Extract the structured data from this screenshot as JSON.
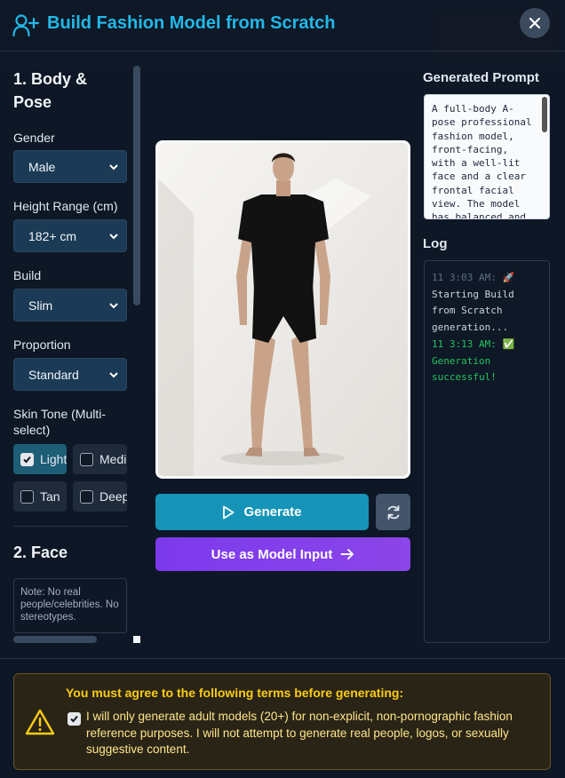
{
  "header": {
    "title": "Build Fashion Model from Scratch",
    "close_symbol": "✕"
  },
  "left": {
    "section1_title": "1. Body & Pose",
    "gender": {
      "label": "Gender",
      "value": "Male"
    },
    "height": {
      "label": "Height Range (cm)",
      "value": "182+ cm"
    },
    "build": {
      "label": "Build",
      "value": "Slim"
    },
    "proportion": {
      "label": "Proportion",
      "value": "Standard"
    },
    "skin": {
      "label": "Skin Tone (Multi-select)",
      "options": [
        {
          "label": "Light",
          "checked": true
        },
        {
          "label": "Mediu",
          "checked": false
        },
        {
          "label": "Tan",
          "checked": false
        },
        {
          "label": "Deep",
          "checked": false
        }
      ]
    },
    "section2_title": "2. Face",
    "note": "Note: No real people/celebrities. No stereotypes."
  },
  "center": {
    "generate_label": "Generate",
    "use_label": "Use as Model Input"
  },
  "right": {
    "prompt_title": "Generated Prompt",
    "prompt_text": "A full-body A-pose professional fashion model, front-facing, with a well-lit face and a clear frontal facial view. The model has balanced and",
    "log_title": "Log",
    "log": [
      {
        "time": "11 3:03 AM:",
        "emoji": "🚀",
        "text": "Starting Build from Scratch generation...",
        "status": "info"
      },
      {
        "time": "11 3:13 AM:",
        "emoji": "✅",
        "text": "Generation successful!",
        "status": "success"
      }
    ]
  },
  "footer": {
    "heading": "You must agree to the following terms before generating:",
    "agree_text": "I will only generate adult models (20+) for non-explicit, non-pornographic fashion reference purposes. I will not attempt to generate real people, logos, or sexually suggestive content.",
    "agreed": true
  },
  "colors": {
    "accent": "#22b8e6",
    "generate": "#1594b8",
    "use_button": "#7c3aed",
    "warning": "#facc15",
    "success": "#22c55e"
  }
}
